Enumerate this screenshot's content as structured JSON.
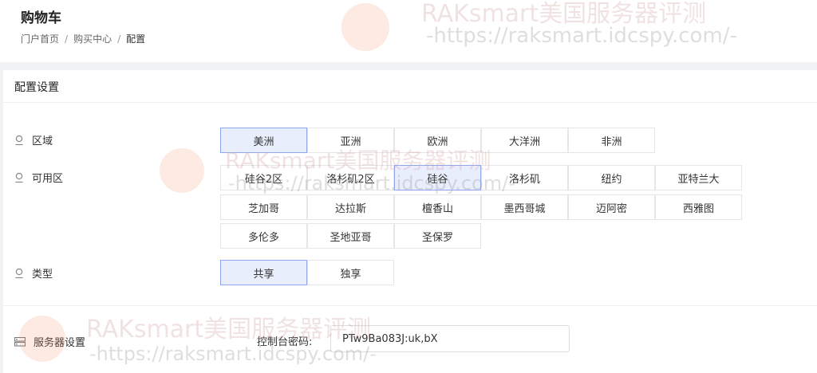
{
  "header": {
    "title": "购物车",
    "breadcrumb": [
      "门户首页",
      "购买中心",
      "配置"
    ],
    "separator": "/"
  },
  "card": {
    "title": "配置设置"
  },
  "region": {
    "label": "区域",
    "options": [
      "美洲",
      "亚洲",
      "欧洲",
      "大洋洲",
      "非洲"
    ],
    "selected": "美洲"
  },
  "zone": {
    "label": "可用区",
    "options": [
      "硅谷2区",
      "洛杉矶2区",
      "硅谷",
      "洛杉矶",
      "纽约",
      "亚特兰大",
      "芝加哥",
      "达拉斯",
      "檀香山",
      "墨西哥城",
      "迈阿密",
      "西雅图",
      "多伦多",
      "圣地亚哥",
      "圣保罗"
    ],
    "selected": "硅谷"
  },
  "type": {
    "label": "类型",
    "options": [
      "共享",
      "独享"
    ],
    "selected": "共享"
  },
  "server": {
    "label": "服务器设置",
    "console_password_label": "控制台密码:",
    "console_password_value": "PTw9Ba083J:uk,bX"
  },
  "watermark": {
    "brand": "RAKsmart美国服务器评测",
    "url": "-https://raksmart.idcspy.com/-"
  },
  "colors": {
    "selected_bg": "#e9eefd",
    "selected_border": "#8fa6ee"
  },
  "icons": {
    "row": "location-pin-icon",
    "server": "server-icon"
  }
}
